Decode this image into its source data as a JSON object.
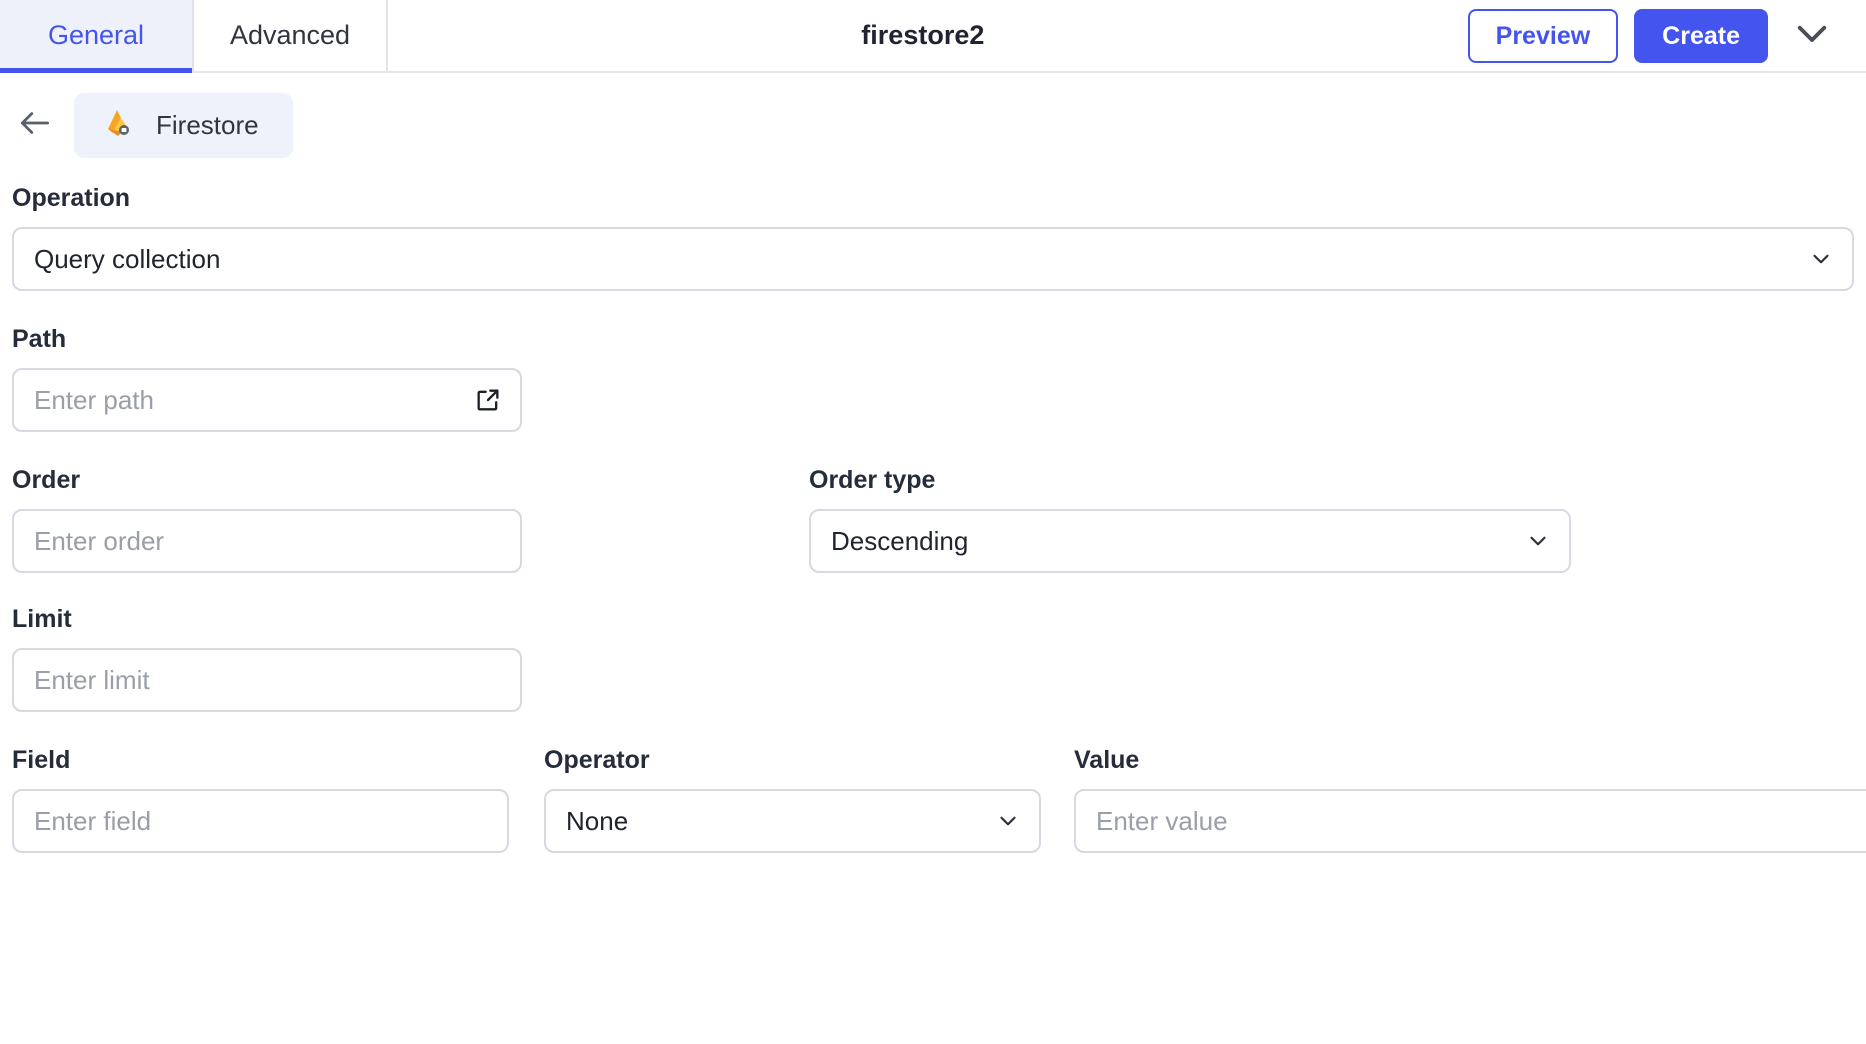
{
  "header": {
    "tabs": [
      {
        "label": "General",
        "active": true
      },
      {
        "label": "Advanced",
        "active": false
      }
    ],
    "title": "firestore2",
    "preview_label": "Preview",
    "create_label": "Create",
    "collapse_icon": "chevron-down-icon",
    "accent_color": "#4355ee",
    "active_tab_bg": "#eef1fa"
  },
  "breadcrumb": {
    "back_icon": "arrow-left-icon",
    "chip_icon": "firebase-firestore-icon",
    "chip_label": "Firestore",
    "chip_bg": "#eef2fb"
  },
  "form": {
    "operation": {
      "label": "Operation",
      "value": "Query collection",
      "icon": "chevron-down-icon"
    },
    "path": {
      "label": "Path",
      "placeholder": "Enter path",
      "value": "",
      "icon": "open-in-new-icon"
    },
    "order": {
      "label": "Order",
      "placeholder": "Enter order",
      "value": ""
    },
    "order_type": {
      "label": "Order type",
      "value": "Descending",
      "icon": "chevron-down-icon"
    },
    "limit": {
      "label": "Limit",
      "placeholder": "Enter limit",
      "value": ""
    },
    "field": {
      "label": "Field",
      "placeholder": "Enter field",
      "value": ""
    },
    "operator": {
      "label": "Operator",
      "value": "None",
      "icon": "chevron-down-icon"
    },
    "value": {
      "label": "Value",
      "placeholder": "Enter value",
      "value": ""
    }
  }
}
